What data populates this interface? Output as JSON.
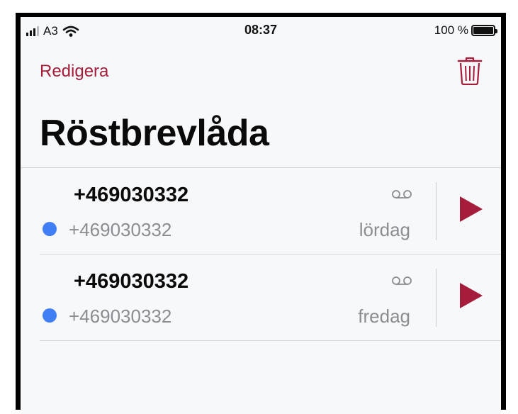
{
  "status_bar": {
    "carrier": "A3",
    "time": "08:37",
    "battery": "100 %"
  },
  "nav": {
    "edit_label": "Redigera",
    "trash_icon": "trash-icon"
  },
  "title": "Röstbrevlåda",
  "colors": {
    "accent": "#a51d3a",
    "unread_dot": "#3f7ef5",
    "secondary_text": "#8a8d92"
  },
  "voicemails": [
    {
      "name": "+469030332",
      "number": "+469030332",
      "day": "lördag",
      "unread": true
    },
    {
      "name": "+469030332",
      "number": "+469030332",
      "day": "fredag",
      "unread": true
    }
  ]
}
